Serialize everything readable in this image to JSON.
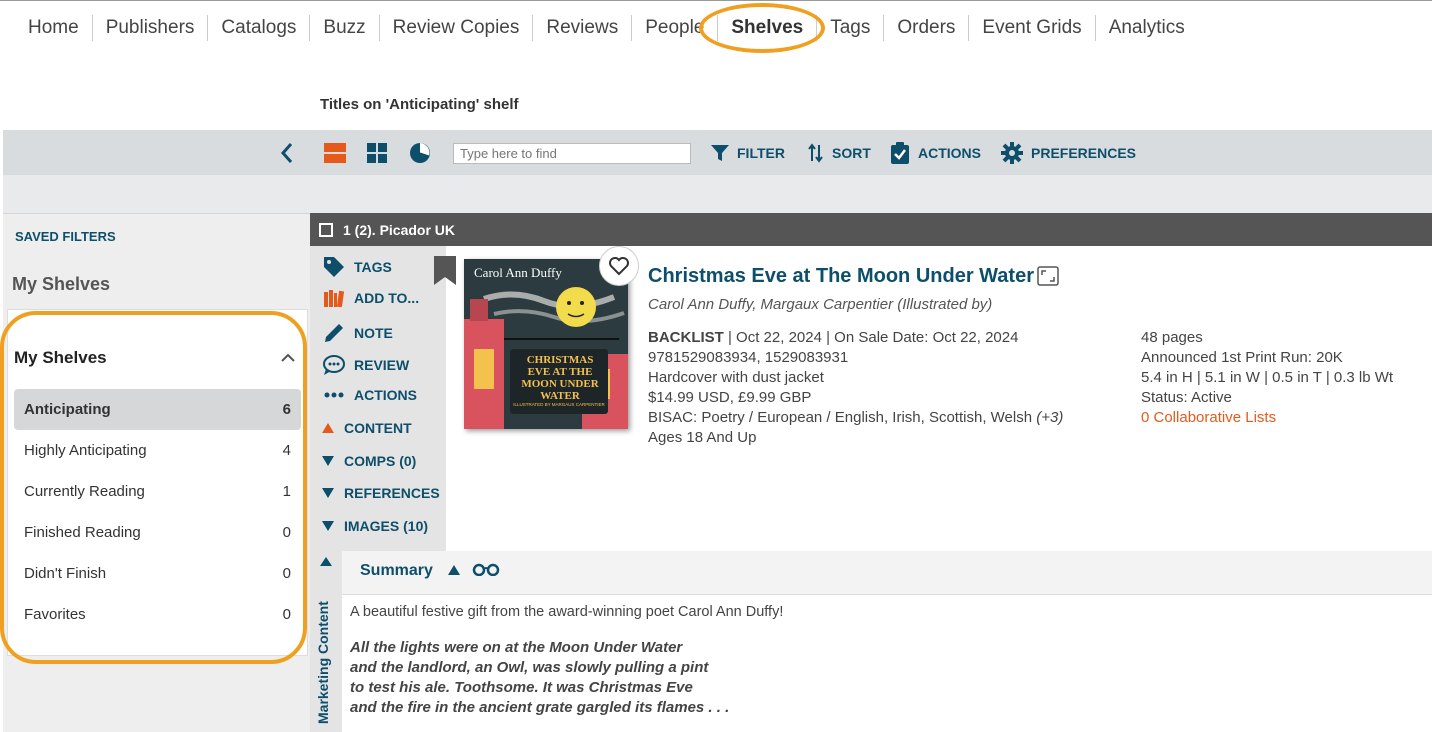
{
  "nav": {
    "items": [
      "Home",
      "Publishers",
      "Catalogs",
      "Buzz",
      "Review Copies",
      "Reviews",
      "People",
      "Shelves",
      "Tags",
      "Orders",
      "Event Grids",
      "Analytics"
    ],
    "active": "Shelves"
  },
  "page_title": "Titles on 'Anticipating' shelf",
  "toolbar": {
    "search_placeholder": "Type here to find",
    "filter": "FILTER",
    "sort": "SORT",
    "actions": "ACTIONS",
    "preferences": "PREFERENCES"
  },
  "sidebar": {
    "saved_filters": "SAVED FILTERS",
    "heading": "My Shelves",
    "card_heading": "My Shelves",
    "shelves": [
      {
        "label": "Anticipating",
        "count": "6"
      },
      {
        "label": "Highly Anticipating",
        "count": "4"
      },
      {
        "label": "Currently Reading",
        "count": "1"
      },
      {
        "label": "Finished Reading",
        "count": "0"
      },
      {
        "label": "Didn't Finish",
        "count": "0"
      },
      {
        "label": "Favorites",
        "count": "0"
      }
    ]
  },
  "group_header": "1 (2). Picador UK",
  "actions": {
    "tags": "TAGS",
    "add_to": "ADD TO...",
    "note": "NOTE",
    "review": "REVIEW",
    "actions": "ACTIONS",
    "content": "CONTENT",
    "comps": "COMPS (0)",
    "references": "REFERENCES",
    "images": "IMAGES (10)"
  },
  "vertical_tab": "Marketing Content",
  "book": {
    "title": "Christmas Eve at The Moon Under Water",
    "authors": "Carol Ann Duffy, Margaux Carpentier (Illustrated by)",
    "format_status": "BACKLIST",
    "dates": " | Oct 22, 2024 | On Sale Date: Oct 22, 2024",
    "isbns": "9781529083934, 1529083931",
    "binding": "Hardcover with dust jacket",
    "price": "$14.99 USD, £9.99 GBP",
    "bisac": "BISAC: Poetry / European / English, Irish, Scottish, Welsh",
    "bisac_more": "(+3)",
    "ages": "Ages 18 And Up",
    "pages": "48 pages",
    "print_run": "Announced 1st Print Run: 20K",
    "dimensions": "5.4 in H | 5.1 in W | 0.5 in T | 0.3 lb Wt",
    "status": "Status: Active",
    "collab_lists": "0 Collaborative Lists",
    "cover_author": "Carol Ann Duffy",
    "cover_title": "CHRISTMAS EVE AT THE MOON UNDER WATER",
    "cover_illustrated": "ILLUSTRATED BY MARGAUX CARPENTIER"
  },
  "summary": {
    "title": "Summary",
    "text": "A beautiful festive gift from the award-winning poet Carol Ann Duffy!",
    "poem": [
      "All the lights were on at the Moon Under Water",
      "and the landlord, an Owl, was slowly pulling a pint",
      "to test his ale. Toothsome. It was Christmas Eve",
      "and the fire in the ancient grate gargled its flames . . ."
    ]
  },
  "colors": {
    "accent_teal": "#0d4f6b",
    "orange": "#e55a1b",
    "highlight": "#f0a020"
  }
}
